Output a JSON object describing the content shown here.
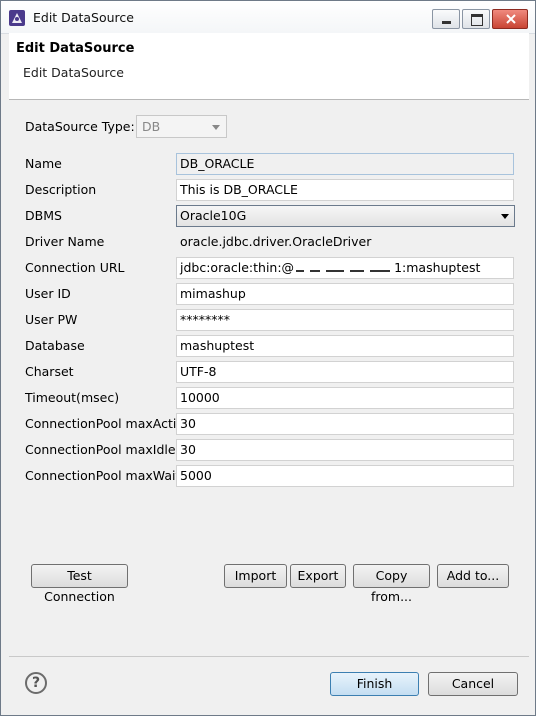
{
  "window": {
    "title": "Edit DataSource",
    "controls": {
      "minimize": "minimize-icon",
      "maximize": "maximize-icon",
      "close": "close-icon"
    }
  },
  "header": {
    "title": "Edit DataSource",
    "subtitle": "Edit DataSource"
  },
  "datasource_type": {
    "label": "DataSource Type:",
    "value": "DB"
  },
  "fields": {
    "name": {
      "label": "Name",
      "value": "DB_ORACLE"
    },
    "description": {
      "label": "Description",
      "value": "This is DB_ORACLE"
    },
    "dbms": {
      "label": "DBMS",
      "value": "Oracle10G"
    },
    "driver_name": {
      "label": "Driver Name",
      "value": "oracle.jdbc.driver.OracleDriver"
    },
    "connection_url": {
      "label": "Connection URL",
      "value_prefix": "jdbc:oracle:thin:@",
      "value_suffix": "1:mashuptest"
    },
    "user_id": {
      "label": "User ID",
      "value": "mimashup"
    },
    "user_pw": {
      "label": "User PW",
      "value": "********"
    },
    "database": {
      "label": "Database",
      "value": "mashuptest"
    },
    "charset": {
      "label": "Charset",
      "value": "UTF-8"
    },
    "timeout": {
      "label": "Timeout(msec)",
      "value": "10000"
    },
    "pool_max_active": {
      "label": "ConnectionPool maxActive",
      "value": "30"
    },
    "pool_max_idle": {
      "label": "ConnectionPool maxIdle",
      "value": "30"
    },
    "pool_max_wait": {
      "label": "ConnectionPool maxWait",
      "value": "5000"
    }
  },
  "actions": {
    "test_connection": "Test Connection",
    "import": "Import",
    "export": "Export",
    "copy_from": "Copy from...",
    "add_to": "Add to..."
  },
  "footer": {
    "help": "?",
    "finish": "Finish",
    "cancel": "Cancel"
  }
}
